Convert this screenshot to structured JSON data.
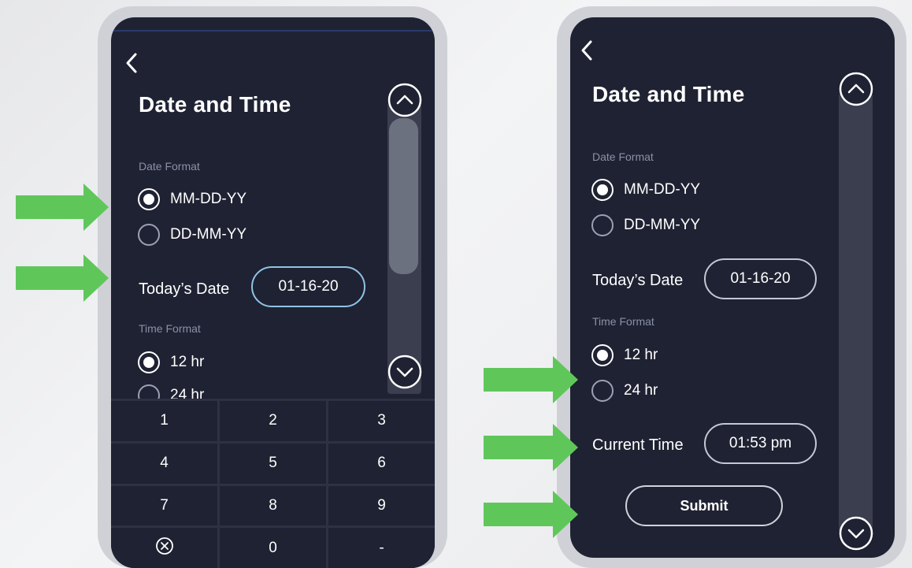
{
  "colors": {
    "screen_bg": "#1f2232",
    "frame": "#cfd1d6",
    "annotation_arrow": "#5fc75a",
    "active_field_border": "#8fc3e6",
    "section_label": "#8a90a8"
  },
  "left_screen": {
    "back_icon": "chevron-left-icon",
    "title": "Date and Time",
    "date_format_label": "Date Format",
    "date_options": [
      "MM-DD-YY",
      "DD-MM-YY"
    ],
    "date_selected": "MM-DD-YY",
    "todays_date_label": "Today’s Date",
    "todays_date_value": "01-16-20",
    "time_format_label": "Time Format",
    "time_options": [
      "12 hr",
      "24 hr"
    ],
    "time_selected": "12 hr",
    "scroll_up_icon": "chevron-up-circle-icon",
    "scroll_down_icon": "chevron-down-circle-icon",
    "keypad": {
      "k1": "1",
      "k2": "2",
      "k3": "3",
      "k4": "4",
      "k5": "5",
      "k6": "6",
      "k7": "7",
      "k8": "8",
      "k9": "9",
      "clear_icon": "clear-circle-x-icon",
      "k0": "0",
      "dash": "-"
    }
  },
  "right_screen": {
    "back_icon": "chevron-left-icon",
    "title": "Date and Time",
    "date_format_label": "Date Format",
    "date_options": [
      "MM-DD-YY",
      "DD-MM-YY"
    ],
    "date_selected": "MM-DD-YY",
    "todays_date_label": "Today’s Date",
    "todays_date_value": "01-16-20",
    "time_format_label": "Time Format",
    "time_options": [
      "12 hr",
      "24 hr"
    ],
    "time_selected": "12 hr",
    "current_time_label": "Current Time",
    "current_time_value": "01:53 pm",
    "submit_label": "Submit",
    "scroll_up_icon": "chevron-up-circle-icon",
    "scroll_down_icon": "chevron-down-circle-icon"
  },
  "annotations": [
    "arrow-right-icon",
    "arrow-right-icon",
    "arrow-right-icon",
    "arrow-right-icon",
    "arrow-right-icon"
  ]
}
